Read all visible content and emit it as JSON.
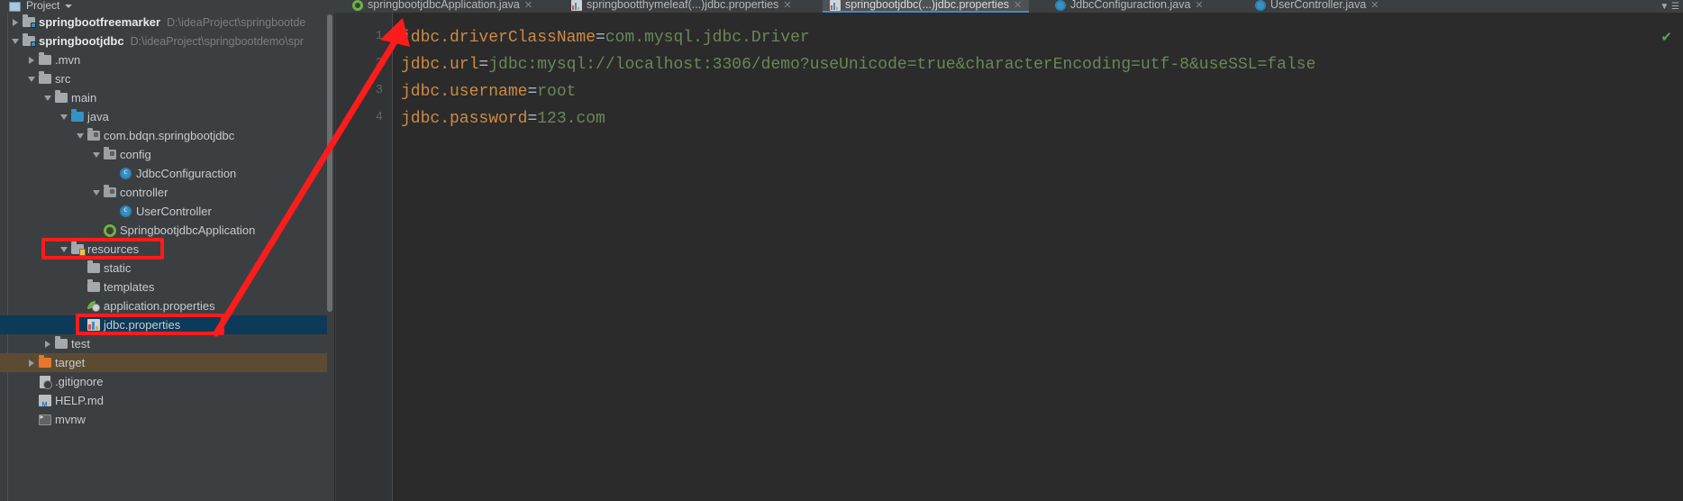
{
  "window": {
    "toolbar": {
      "panel_title": "Project",
      "icons": [
        "project-icon",
        "chevron-down-icon",
        "help-icon",
        "collapse-icon",
        "settings-icon"
      ]
    }
  },
  "project_panel": {
    "title": "Project",
    "tree": [
      {
        "depth": 0,
        "label": "springbootfreemarker",
        "path": "D:\\ideaProject\\springbootde",
        "icon": "module-folder-icon",
        "twisty": "closed",
        "bold": true
      },
      {
        "depth": 0,
        "label": "springbootjdbc",
        "path": "D:\\ideaProject\\springbootdemo\\spr",
        "icon": "module-folder-icon",
        "twisty": "open",
        "bold": true
      },
      {
        "depth": 1,
        "label": ".mvn",
        "icon": "folder-icon",
        "twisty": "closed",
        "bold": false
      },
      {
        "depth": 1,
        "label": "src",
        "icon": "folder-icon",
        "twisty": "open",
        "bold": false
      },
      {
        "depth": 2,
        "label": "main",
        "icon": "folder-icon",
        "twisty": "open",
        "bold": false
      },
      {
        "depth": 3,
        "label": "java",
        "icon": "source-folder-icon",
        "twisty": "open",
        "bold": false
      },
      {
        "depth": 4,
        "label": "com.bdqn.springbootjdbc",
        "icon": "package-icon",
        "twisty": "open",
        "bold": false
      },
      {
        "depth": 5,
        "label": "config",
        "icon": "package-icon",
        "twisty": "open",
        "bold": false
      },
      {
        "depth": 6,
        "label": "JdbcConfiguraction",
        "icon": "java-class-icon",
        "twisty": "none",
        "bold": false
      },
      {
        "depth": 5,
        "label": "controller",
        "icon": "package-icon",
        "twisty": "open",
        "bold": false
      },
      {
        "depth": 6,
        "label": "UserController",
        "icon": "java-class-icon",
        "twisty": "none",
        "bold": false
      },
      {
        "depth": 5,
        "label": "SpringbootjdbcApplication",
        "icon": "spring-boot-class-icon",
        "twisty": "none",
        "bold": false
      },
      {
        "depth": 3,
        "label": "resources",
        "icon": "resources-folder-icon",
        "twisty": "open",
        "bold": false,
        "annotated": true
      },
      {
        "depth": 4,
        "label": "static",
        "icon": "folder-icon",
        "twisty": "none",
        "bold": false
      },
      {
        "depth": 4,
        "label": "templates",
        "icon": "folder-icon",
        "twisty": "none",
        "bold": false
      },
      {
        "depth": 4,
        "label": "application.properties",
        "icon": "spring-properties-icon",
        "twisty": "none",
        "bold": false
      },
      {
        "depth": 4,
        "label": "jdbc.properties",
        "icon": "properties-file-icon",
        "twisty": "none",
        "bold": false,
        "selected": true,
        "annotated": true
      },
      {
        "depth": 2,
        "label": "test",
        "icon": "folder-icon",
        "twisty": "closed",
        "bold": false
      },
      {
        "depth": 1,
        "label": "target",
        "icon": "excluded-folder-icon",
        "twisty": "closed",
        "bold": false,
        "excluded": true
      },
      {
        "depth": 1,
        "label": ".gitignore",
        "icon": "gitignore-icon",
        "twisty": "none",
        "bold": false
      },
      {
        "depth": 1,
        "label": "HELP.md",
        "icon": "markdown-icon",
        "twisty": "none",
        "bold": false
      },
      {
        "depth": 1,
        "label": "mvnw",
        "icon": "shell-script-icon",
        "twisty": "none",
        "bold": false
      }
    ]
  },
  "tabs": {
    "items": [
      {
        "label": "springbootjdbcApplication.java",
        "icon": "spring-boot-class-icon",
        "active": false
      },
      {
        "label": "springbootthymeleaf(...)jdbc.properties",
        "icon": "properties-file-icon",
        "active": false
      },
      {
        "label": "springbootjdbc(...)jdbc.properties",
        "icon": "properties-file-icon",
        "active": true
      },
      {
        "label": "JdbcConfiguraction.java",
        "icon": "java-class-icon",
        "active": false
      },
      {
        "label": "UserController.java",
        "icon": "java-class-icon",
        "active": false
      }
    ],
    "overflow_icon": "chevron-down-icon"
  },
  "editor": {
    "status_icon": "inspection-ok-check-icon",
    "line_numbers": [
      "1",
      "2",
      "3",
      "4"
    ],
    "lines": [
      {
        "num": "1",
        "key": "jdbc.driverClassName",
        "eq": "=",
        "value": "com.mysql.jdbc.Driver"
      },
      {
        "num": "2",
        "key": "jdbc.url",
        "eq": "=",
        "value": "jdbc:mysql://localhost:3306/demo?useUnicode=true&characterEncoding=utf-8&useSSL=false"
      },
      {
        "num": "3",
        "key": "jdbc.username",
        "eq": "=",
        "value": "root"
      },
      {
        "num": "4",
        "key": "jdbc.password",
        "eq": "=",
        "value": "123.com"
      }
    ]
  },
  "annotations": {
    "color": "#fc1c1c",
    "boxes": [
      {
        "name": "resources-highlight-box"
      },
      {
        "name": "jdbc-properties-highlight-box"
      }
    ],
    "arrow": {
      "name": "red-pointer-arrow",
      "from": "jdbc.properties node",
      "to": "editor line 1"
    }
  },
  "colors": {
    "accent_blue": "#4a88c7",
    "selection_blue": "#0d3a58",
    "excluded_brown": "#5c4b33",
    "editor_bg": "#2b2b2b",
    "panel_bg": "#3c3f41",
    "key_orange": "#cc8b45",
    "value_green": "#6a8759",
    "annotation_red": "#fc1c1c"
  }
}
